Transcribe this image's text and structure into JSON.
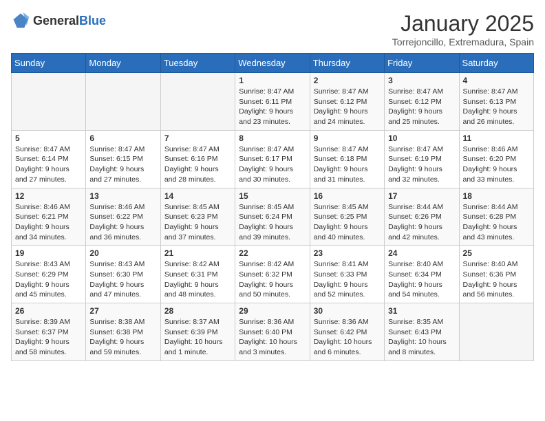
{
  "logo": {
    "general": "General",
    "blue": "Blue"
  },
  "title": "January 2025",
  "location": "Torrejoncillo, Extremadura, Spain",
  "headers": [
    "Sunday",
    "Monday",
    "Tuesday",
    "Wednesday",
    "Thursday",
    "Friday",
    "Saturday"
  ],
  "weeks": [
    [
      {
        "day": "",
        "info": ""
      },
      {
        "day": "",
        "info": ""
      },
      {
        "day": "",
        "info": ""
      },
      {
        "day": "1",
        "info": "Sunrise: 8:47 AM\nSunset: 6:11 PM\nDaylight: 9 hours\nand 23 minutes."
      },
      {
        "day": "2",
        "info": "Sunrise: 8:47 AM\nSunset: 6:12 PM\nDaylight: 9 hours\nand 24 minutes."
      },
      {
        "day": "3",
        "info": "Sunrise: 8:47 AM\nSunset: 6:12 PM\nDaylight: 9 hours\nand 25 minutes."
      },
      {
        "day": "4",
        "info": "Sunrise: 8:47 AM\nSunset: 6:13 PM\nDaylight: 9 hours\nand 26 minutes."
      }
    ],
    [
      {
        "day": "5",
        "info": "Sunrise: 8:47 AM\nSunset: 6:14 PM\nDaylight: 9 hours\nand 27 minutes."
      },
      {
        "day": "6",
        "info": "Sunrise: 8:47 AM\nSunset: 6:15 PM\nDaylight: 9 hours\nand 27 minutes."
      },
      {
        "day": "7",
        "info": "Sunrise: 8:47 AM\nSunset: 6:16 PM\nDaylight: 9 hours\nand 28 minutes."
      },
      {
        "day": "8",
        "info": "Sunrise: 8:47 AM\nSunset: 6:17 PM\nDaylight: 9 hours\nand 30 minutes."
      },
      {
        "day": "9",
        "info": "Sunrise: 8:47 AM\nSunset: 6:18 PM\nDaylight: 9 hours\nand 31 minutes."
      },
      {
        "day": "10",
        "info": "Sunrise: 8:47 AM\nSunset: 6:19 PM\nDaylight: 9 hours\nand 32 minutes."
      },
      {
        "day": "11",
        "info": "Sunrise: 8:46 AM\nSunset: 6:20 PM\nDaylight: 9 hours\nand 33 minutes."
      }
    ],
    [
      {
        "day": "12",
        "info": "Sunrise: 8:46 AM\nSunset: 6:21 PM\nDaylight: 9 hours\nand 34 minutes."
      },
      {
        "day": "13",
        "info": "Sunrise: 8:46 AM\nSunset: 6:22 PM\nDaylight: 9 hours\nand 36 minutes."
      },
      {
        "day": "14",
        "info": "Sunrise: 8:45 AM\nSunset: 6:23 PM\nDaylight: 9 hours\nand 37 minutes."
      },
      {
        "day": "15",
        "info": "Sunrise: 8:45 AM\nSunset: 6:24 PM\nDaylight: 9 hours\nand 39 minutes."
      },
      {
        "day": "16",
        "info": "Sunrise: 8:45 AM\nSunset: 6:25 PM\nDaylight: 9 hours\nand 40 minutes."
      },
      {
        "day": "17",
        "info": "Sunrise: 8:44 AM\nSunset: 6:26 PM\nDaylight: 9 hours\nand 42 minutes."
      },
      {
        "day": "18",
        "info": "Sunrise: 8:44 AM\nSunset: 6:28 PM\nDaylight: 9 hours\nand 43 minutes."
      }
    ],
    [
      {
        "day": "19",
        "info": "Sunrise: 8:43 AM\nSunset: 6:29 PM\nDaylight: 9 hours\nand 45 minutes."
      },
      {
        "day": "20",
        "info": "Sunrise: 8:43 AM\nSunset: 6:30 PM\nDaylight: 9 hours\nand 47 minutes."
      },
      {
        "day": "21",
        "info": "Sunrise: 8:42 AM\nSunset: 6:31 PM\nDaylight: 9 hours\nand 48 minutes."
      },
      {
        "day": "22",
        "info": "Sunrise: 8:42 AM\nSunset: 6:32 PM\nDaylight: 9 hours\nand 50 minutes."
      },
      {
        "day": "23",
        "info": "Sunrise: 8:41 AM\nSunset: 6:33 PM\nDaylight: 9 hours\nand 52 minutes."
      },
      {
        "day": "24",
        "info": "Sunrise: 8:40 AM\nSunset: 6:34 PM\nDaylight: 9 hours\nand 54 minutes."
      },
      {
        "day": "25",
        "info": "Sunrise: 8:40 AM\nSunset: 6:36 PM\nDaylight: 9 hours\nand 56 minutes."
      }
    ],
    [
      {
        "day": "26",
        "info": "Sunrise: 8:39 AM\nSunset: 6:37 PM\nDaylight: 9 hours\nand 58 minutes."
      },
      {
        "day": "27",
        "info": "Sunrise: 8:38 AM\nSunset: 6:38 PM\nDaylight: 9 hours\nand 59 minutes."
      },
      {
        "day": "28",
        "info": "Sunrise: 8:37 AM\nSunset: 6:39 PM\nDaylight: 10 hours\nand 1 minute."
      },
      {
        "day": "29",
        "info": "Sunrise: 8:36 AM\nSunset: 6:40 PM\nDaylight: 10 hours\nand 3 minutes."
      },
      {
        "day": "30",
        "info": "Sunrise: 8:36 AM\nSunset: 6:42 PM\nDaylight: 10 hours\nand 6 minutes."
      },
      {
        "day": "31",
        "info": "Sunrise: 8:35 AM\nSunset: 6:43 PM\nDaylight: 10 hours\nand 8 minutes."
      },
      {
        "day": "",
        "info": ""
      }
    ]
  ]
}
